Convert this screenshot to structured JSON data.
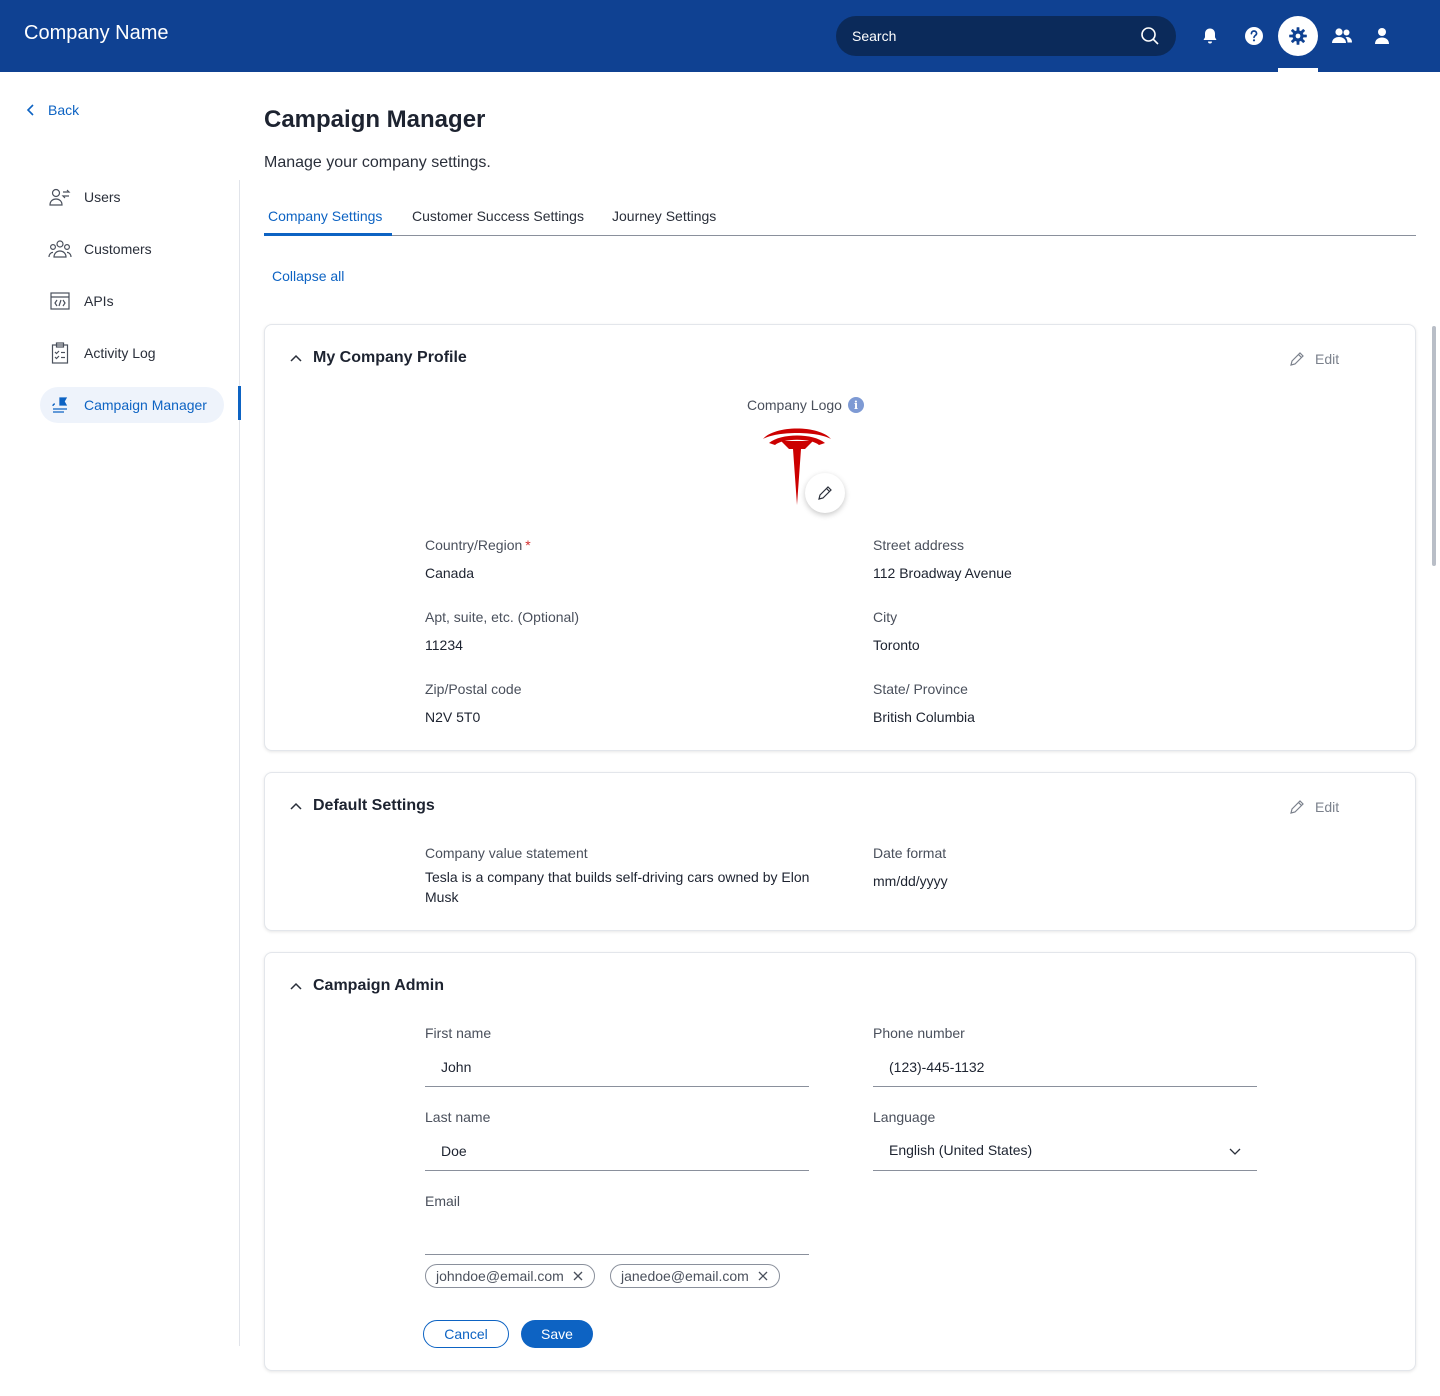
{
  "header": {
    "brand": "Company Name",
    "search_placeholder": "Search",
    "icons": [
      "bell-icon",
      "help-icon",
      "gear-icon",
      "team-icon",
      "user-icon"
    ]
  },
  "sidebar": {
    "back_label": "Back",
    "items": [
      {
        "label": "Users",
        "icon": "user-switch-icon"
      },
      {
        "label": "Customers",
        "icon": "group-icon"
      },
      {
        "label": "APIs",
        "icon": "code-window-icon"
      },
      {
        "label": "Activity Log",
        "icon": "clipboard-icon"
      },
      {
        "label": "Campaign Manager",
        "icon": "campaign-icon",
        "active": true
      }
    ]
  },
  "main": {
    "title": "Campaign Manager",
    "subtitle": "Manage your company settings.",
    "tabs": [
      {
        "label": "Company Settings",
        "active": true
      },
      {
        "label": "Customer Success Settings"
      },
      {
        "label": "Journey Settings"
      }
    ],
    "collapse_all": "Collapse all"
  },
  "profile": {
    "title": "My Company Profile",
    "edit_label": "Edit",
    "logo_label": "Company Logo",
    "info_glyph": "i",
    "fields": {
      "country_label": "Country/Region",
      "country_value": "Canada",
      "required_mark": "*",
      "street_label": "Street address",
      "street_value": "112 Broadway Avenue",
      "apt_label": "Apt, suite, etc. (Optional)",
      "apt_value": "11234",
      "city_label": "City",
      "city_value": "Toronto",
      "zip_label": "Zip/Postal code",
      "zip_value": "N2V 5T0",
      "state_label": "State/ Province",
      "state_value": "British Columbia"
    }
  },
  "defaults": {
    "title": "Default Settings",
    "edit_label": "Edit",
    "value_statement_label": "Company value statement",
    "value_statement": "Tesla is a company that builds self-driving cars owned by Elon Musk",
    "date_format_label": "Date format",
    "date_format": "mm/dd/yyyy"
  },
  "admin": {
    "title": "Campaign Admin",
    "first_name_label": "First name",
    "first_name": "John",
    "phone_label": "Phone number",
    "phone": "(123)-445-1132",
    "last_name_label": "Last name",
    "last_name": "Doe",
    "language_label": "Language",
    "language": "English (United States)",
    "email_label": "Email",
    "email_chips": [
      "johndoe@email.com",
      "janedoe@email.com"
    ],
    "cancel_label": "Cancel",
    "save_label": "Save"
  },
  "colors": {
    "topbar": "#0f4192",
    "accent": "#0d63c3",
    "logo_red": "#cc0000"
  }
}
